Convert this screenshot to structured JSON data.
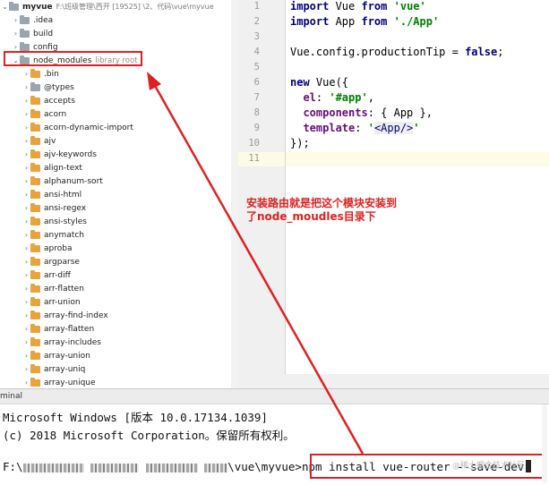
{
  "project_tree": {
    "project_name": "myvue",
    "project_path": "F:\\班级管理\\西开 [19525] \\2、代码\\vue\\myvue",
    "library_root_label": "library root",
    "rows": [
      {
        "label": "myvue",
        "folder": "grey",
        "expanded": true,
        "indent": 0
      },
      {
        "label": ".idea",
        "folder": "grey",
        "expanded": false,
        "indent": 1
      },
      {
        "label": "build",
        "folder": "grey",
        "expanded": false,
        "indent": 1
      },
      {
        "label": "config",
        "folder": "grey",
        "expanded": false,
        "indent": 1
      },
      {
        "label": "node_modules",
        "folder": "grey",
        "expanded": true,
        "indent": 1
      },
      {
        "label": ".bin",
        "folder": "orange",
        "expanded": false,
        "indent": 2
      },
      {
        "label": "@types",
        "folder": "grey",
        "expanded": false,
        "indent": 2
      },
      {
        "label": "accepts",
        "folder": "orange",
        "expanded": false,
        "indent": 2
      },
      {
        "label": "acorn",
        "folder": "orange",
        "expanded": false,
        "indent": 2
      },
      {
        "label": "acorn-dynamic-import",
        "folder": "orange",
        "expanded": false,
        "indent": 2
      },
      {
        "label": "ajv",
        "folder": "orange",
        "expanded": false,
        "indent": 2
      },
      {
        "label": "ajv-keywords",
        "folder": "orange",
        "expanded": false,
        "indent": 2
      },
      {
        "label": "align-text",
        "folder": "orange",
        "expanded": false,
        "indent": 2
      },
      {
        "label": "alphanum-sort",
        "folder": "orange",
        "expanded": false,
        "indent": 2
      },
      {
        "label": "ansi-html",
        "folder": "orange",
        "expanded": false,
        "indent": 2
      },
      {
        "label": "ansi-regex",
        "folder": "orange",
        "expanded": false,
        "indent": 2
      },
      {
        "label": "ansi-styles",
        "folder": "orange",
        "expanded": false,
        "indent": 2
      },
      {
        "label": "anymatch",
        "folder": "orange",
        "expanded": false,
        "indent": 2
      },
      {
        "label": "aproba",
        "folder": "orange",
        "expanded": false,
        "indent": 2
      },
      {
        "label": "argparse",
        "folder": "orange",
        "expanded": false,
        "indent": 2
      },
      {
        "label": "arr-diff",
        "folder": "orange",
        "expanded": false,
        "indent": 2
      },
      {
        "label": "arr-flatten",
        "folder": "orange",
        "expanded": false,
        "indent": 2
      },
      {
        "label": "arr-union",
        "folder": "orange",
        "expanded": false,
        "indent": 2
      },
      {
        "label": "array-find-index",
        "folder": "orange",
        "expanded": false,
        "indent": 2
      },
      {
        "label": "array-flatten",
        "folder": "orange",
        "expanded": false,
        "indent": 2
      },
      {
        "label": "array-includes",
        "folder": "orange",
        "expanded": false,
        "indent": 2
      },
      {
        "label": "array-union",
        "folder": "orange",
        "expanded": false,
        "indent": 2
      },
      {
        "label": "array-uniq",
        "folder": "orange",
        "expanded": false,
        "indent": 2
      },
      {
        "label": "array-unique",
        "folder": "orange",
        "expanded": false,
        "indent": 2
      }
    ]
  },
  "editor": {
    "line_numbers": [
      "1",
      "2",
      "3",
      "4",
      "5",
      "6",
      "7",
      "8",
      "9",
      "10",
      "11"
    ],
    "lines": [
      [
        {
          "t": "import",
          "c": "kw"
        },
        {
          "t": " Vue ",
          "c": "punc"
        },
        {
          "t": "from",
          "c": "kw"
        },
        {
          "t": " ",
          "c": "punc"
        },
        {
          "t": "'vue'",
          "c": "str"
        }
      ],
      [
        {
          "t": "import",
          "c": "kw"
        },
        {
          "t": " App ",
          "c": "punc"
        },
        {
          "t": "from",
          "c": "kw"
        },
        {
          "t": " ",
          "c": "punc"
        },
        {
          "t": "'./App'",
          "c": "str"
        }
      ],
      [],
      [
        {
          "t": "Vue.config.productionTip = ",
          "c": "punc"
        },
        {
          "t": "false",
          "c": "kw"
        },
        {
          "t": ";",
          "c": "punc"
        }
      ],
      [],
      [
        {
          "t": "new",
          "c": "kw"
        },
        {
          "t": " Vue({",
          "c": "punc"
        }
      ],
      [
        {
          "t": "  ",
          "c": "punc"
        },
        {
          "t": "el",
          "c": "prop"
        },
        {
          "t": ": ",
          "c": "punc"
        },
        {
          "t": "'#app'",
          "c": "str"
        },
        {
          "t": ",",
          "c": "punc"
        }
      ],
      [
        {
          "t": "  ",
          "c": "punc"
        },
        {
          "t": "components",
          "c": "prop"
        },
        {
          "t": ": { App },",
          "c": "punc"
        }
      ],
      [
        {
          "t": "  ",
          "c": "punc"
        },
        {
          "t": "template",
          "c": "prop"
        },
        {
          "t": ": ",
          "c": "punc"
        },
        {
          "t": "'",
          "c": "str"
        },
        {
          "t": "<App/>",
          "c": "tag"
        },
        {
          "t": "'",
          "c": "str"
        }
      ],
      [
        {
          "t": "});",
          "c": "punc"
        }
      ],
      []
    ]
  },
  "annotation": {
    "line1": "安装路由就是把这个模块安装到",
    "line2": "了node_moudles目录下"
  },
  "terminal": {
    "tab_label": "minal",
    "line1": "Microsoft Windows [版本 10.0.17134.1039]",
    "line2": "(c) 2018 Microsoft Corporation。保留所有权利。",
    "prompt_drive": "F:\\",
    "prompt_path": "\\vue\\myvue>",
    "command": "npm install vue-router --save-dev",
    "watermark": "@稀土掘金技术社区"
  },
  "colors": {
    "annotation_red": "#e02020",
    "keyword": "#000080",
    "string": "#008000",
    "property": "#660e7a"
  }
}
